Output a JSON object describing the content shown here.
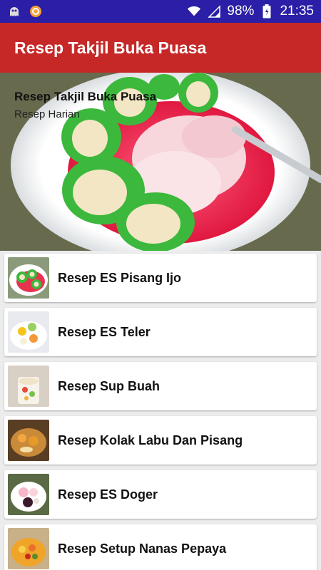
{
  "status_bar": {
    "battery": "98%",
    "time": "21:35",
    "icons": [
      "ghost-icon",
      "app-notification-icon",
      "wifi-icon",
      "signal-icon",
      "battery-icon"
    ]
  },
  "app_bar": {
    "title": "Resep Takjil Buka Puasa"
  },
  "hero": {
    "title": "Resep Takjil Buka Puasa",
    "subtitle": "Resep Harian"
  },
  "recipes": [
    {
      "label": "Resep ES Pisang Ijo"
    },
    {
      "label": "Resep ES Teler"
    },
    {
      "label": "Resep Sup Buah"
    },
    {
      "label": "Resep Kolak Labu Dan Pisang"
    },
    {
      "label": "Resep ES Doger"
    },
    {
      "label": "Resep Setup Nanas Pepaya"
    }
  ],
  "colors": {
    "status_bar": "#2a1fa6",
    "app_bar": "#c62828",
    "background": "#ececec",
    "card": "#ffffff"
  }
}
